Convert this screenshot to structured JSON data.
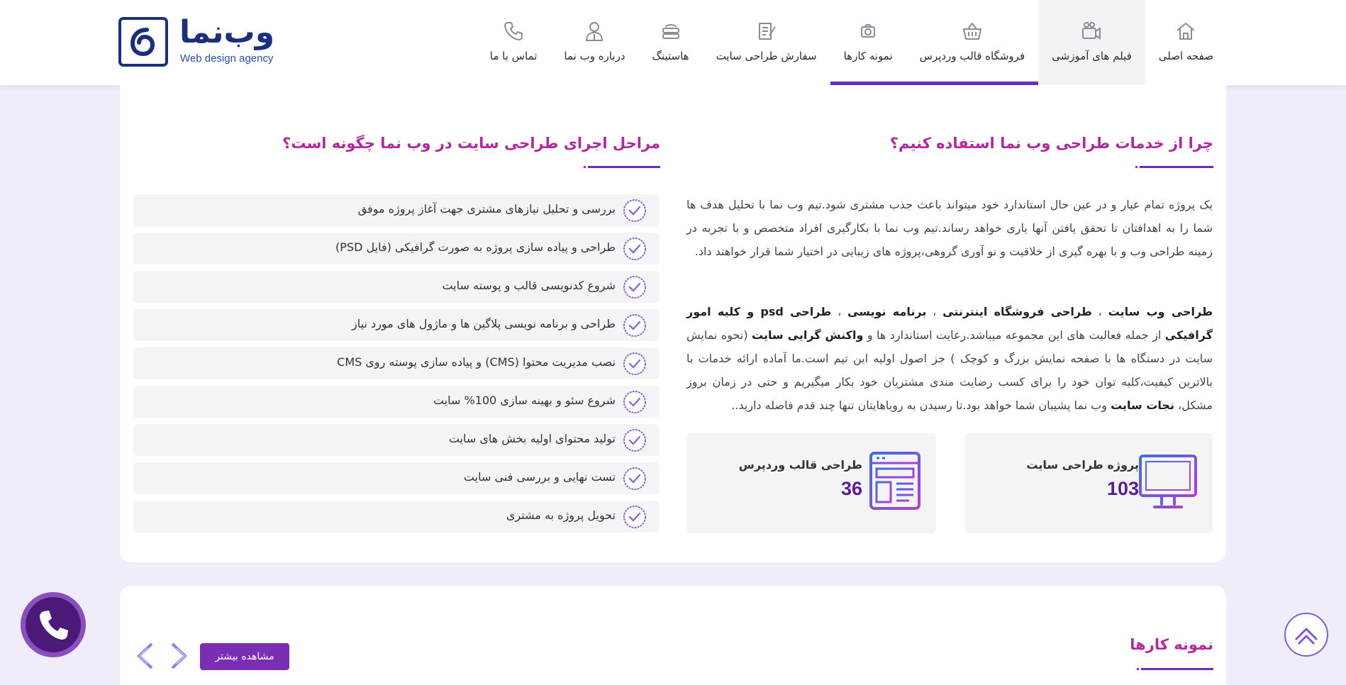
{
  "brand": {
    "logo_text": "وب‌نما",
    "tagline": "Web design agency"
  },
  "nav": {
    "items": [
      {
        "label": "صفحه اصلی",
        "icon": "home-icon"
      },
      {
        "label": "فیلم های آموزشی",
        "icon": "video-icon"
      },
      {
        "label": "فروشگاه قالب وردپرس",
        "icon": "basket-icon"
      },
      {
        "label": "نمونه کارها",
        "icon": "camera-icon"
      },
      {
        "label": "سفارش طراحی سایت",
        "icon": "order-icon"
      },
      {
        "label": "هاستینگ",
        "icon": "server-icon"
      },
      {
        "label": "درباره وب نما",
        "icon": "user-icon"
      },
      {
        "label": "تماس با ما",
        "icon": "phone-icon"
      }
    ],
    "active_index": 1
  },
  "why": {
    "title": "چرا از خدمات طراحی وب نما استفاده کنیم؟",
    "paragraph1": "یک پروژه تمام عیار و در عین حال استاندارد خود میتواند باعث جذب مشتری شود.تیم وب نما با تحلیل هدف ها شما را به اهدافتان تا تحقق یافتن آنها یاری خواهد رساند.تیم وب نما با بکارگیری افراد متخصص و با تجربه در زمینه طراحی وب و با بهره گیری از خلاقیت و نو آوری گروهی،پروژه های زیبایی در اختیار شما قرار خواهند داد.",
    "p2_b1": "طراحی وب سایت",
    "p2_t1": " ، ",
    "p2_b2": "طراحی فروشگاه اینترنتی",
    "p2_t2": " ، ",
    "p2_b3": "برنامه نویسی",
    "p2_t3": " ، ",
    "p2_b4": "طراحی psd و کلیه امور گرافیکی",
    "p2_t4": " از جمله فعالیت های این مجموعه میباشد.رعایت استاندارد ها و ",
    "p2_b5": "واکنش گرایی سایت",
    "p2_t5": " (نحوه نمایش سایت در دستگاه ها با صفحه نمایش بزرگ و کوچک ) جز اصول اولیه این تیم است.ما آماده ارائه خدمات با بالاترین کیفیت،کلیه توان خود را برای کسب رضایت مندی مشتریان خود بکار میگیریم و حتی در زمان بروز مشکل، ",
    "p2_b6": "نجات سایت",
    "p2_t6": " وب نما پشیبان شما خواهد بود.تا رسیدن به رویاهایتان تنها چند قدم فاصله دارید.."
  },
  "stats": [
    {
      "label": "پروژه طراحی سایت",
      "value": "103",
      "icon": "monitor-icon"
    },
    {
      "label": "طراحی قالب وردپرس",
      "value": "36",
      "icon": "template-icon"
    }
  ],
  "steps": {
    "title": "مراحل اجرای طراحی سایت در وب نما چگونه است؟",
    "items": [
      "بررسی و تحلیل نیازهای مشتری جهت آغاز پروژه موفق",
      "طراحی و پیاده سازی پروژه به صورت گرافیکی (فایل PSD)",
      "شروع کدنویسی قالب و پوسته سایت",
      "طراحی و برنامه نویسی پلاگین ها و ماژول های مورد نیاز",
      "نصب مدیریت محتوا (CMS) و پیاده سازی پوسته روی CMS",
      "شروع سئو و بهینه سازی 100% سایت",
      "تولید محتوای اولیه بخش های سایت",
      "تست نهایی و بررسی فنی سایت",
      "تحویل پروژه به مشتری"
    ]
  },
  "portfolio": {
    "title": "نمونه کارها",
    "more_label": "مشاهده بیشتر"
  },
  "colors": {
    "accent": "#6a2fb7",
    "title": "#b02a9c",
    "brand_blue": "#1c2f7a"
  }
}
